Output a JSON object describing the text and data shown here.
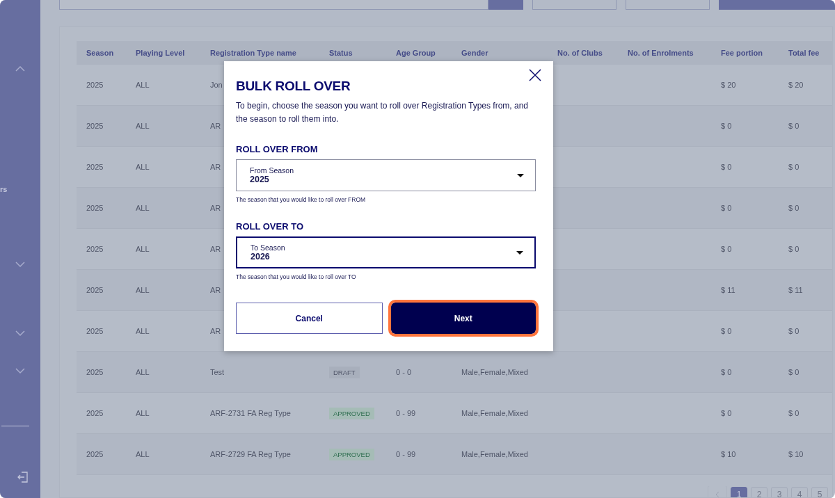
{
  "sidebar": {
    "items": [
      {
        "kind": "chevron-up"
      },
      {
        "kind": "text",
        "label": "rs"
      },
      {
        "kind": "chevron-down"
      },
      {
        "kind": "chevron-down"
      },
      {
        "kind": "chevron-down"
      },
      {
        "kind": "divider"
      },
      {
        "kind": "logout"
      }
    ]
  },
  "table": {
    "columns": [
      "Season",
      "Playing Level",
      "Registration Type name",
      "Status",
      "Age Group",
      "Gender",
      "No. of Clubs",
      "No. of Enrolments",
      "Fee portion",
      "Total fee"
    ],
    "rows": [
      {
        "season": "2025",
        "level": "ALL",
        "name": "Jon",
        "fee": "$ 20",
        "total": "$ 20"
      },
      {
        "season": "2025",
        "level": "ALL",
        "name": "AR",
        "fee": "$ 0",
        "total": "$ 0"
      },
      {
        "season": "2025",
        "level": "ALL",
        "name": "AR",
        "fee": "$ 0",
        "total": "$ 0"
      },
      {
        "season": "2025",
        "level": "ALL",
        "name": "AR",
        "fee": "$ 0",
        "total": "$ 0"
      },
      {
        "season": "2025",
        "level": "ALL",
        "name": "AR",
        "fee": "$ 0",
        "total": "$ 0"
      },
      {
        "season": "2025",
        "level": "ALL",
        "name": "AR",
        "fee": "$ 11",
        "total": "$ 11"
      },
      {
        "season": "2025",
        "level": "ALL",
        "name": "AR",
        "fee": "$ 0",
        "total": "$ 0"
      },
      {
        "season": "2025",
        "level": "ALL",
        "name": "Test",
        "status": {
          "label": "DRAFT",
          "kind": "draft"
        },
        "age": "0 - 0",
        "gender": "Male,Female,Mixed",
        "fee": "$ 0",
        "total": "$ 0"
      },
      {
        "season": "2025",
        "level": "ALL",
        "name": "ARF-2731 FA Reg Type",
        "status": {
          "label": "APPROVED",
          "kind": "approved"
        },
        "age": "0 - 99",
        "gender": "Male,Female,Mixed",
        "fee": "$ 0",
        "total": "$ 0"
      },
      {
        "season": "2025",
        "level": "ALL",
        "name": "ARF-2729 FA Reg Type",
        "status": {
          "label": "APPROVED",
          "kind": "approved"
        },
        "age": "0 - 99",
        "gender": "Male,Female,Mixed",
        "fee": "$ 10",
        "total": "$ 10"
      }
    ]
  },
  "pagination": {
    "pages": [
      {
        "label": "1",
        "selected": true
      },
      {
        "label": "2",
        "selected": false
      },
      {
        "label": "3",
        "selected": false
      },
      {
        "label": "4",
        "selected": false
      },
      {
        "label": "5",
        "selected": false
      }
    ]
  },
  "dialog": {
    "title": "BULK ROLL OVER",
    "description": "To begin, choose the season you want to roll over Registration Types from, and the season to roll them into.",
    "sections": [
      {
        "heading": "ROLL OVER FROM",
        "label": "From Season",
        "value": "2025",
        "focused": false,
        "helper": "The season that you would like to roll over FROM"
      },
      {
        "heading": "ROLL OVER TO",
        "label": "To Season",
        "value": "2026",
        "focused": true,
        "helper": "The season that you would like to roll over TO"
      }
    ],
    "buttons": [
      {
        "label": "Cancel",
        "kind": "secondary",
        "highlighted": false
      },
      {
        "label": "Next",
        "kind": "primary",
        "highlighted": true
      }
    ]
  }
}
